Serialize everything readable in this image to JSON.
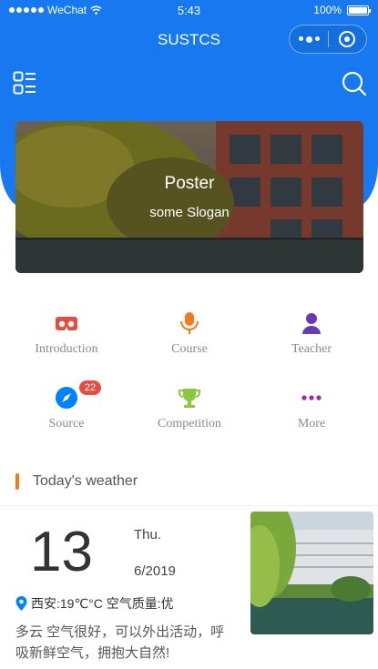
{
  "status_bar": {
    "carrier": "WeChat",
    "time": "5:43",
    "battery": "100%",
    "battery_level": 1.0
  },
  "nav": {
    "title": "SUSTCS"
  },
  "toolbar": {
    "menu_icon": "list-icon",
    "search_icon": "search-icon"
  },
  "banner": {
    "title": "Poster",
    "slogan": "some Slogan"
  },
  "grid": [
    {
      "label": "Introduction",
      "icon": "vr-glasses-icon",
      "color": "#e54d42"
    },
    {
      "label": "Course",
      "icon": "microphone-icon",
      "color": "#f37b1d"
    },
    {
      "label": "Teacher",
      "icon": "person-icon",
      "color": "#6739b6"
    },
    {
      "label": "Source",
      "icon": "compass-icon",
      "color": "#0081ff",
      "badge": "22"
    },
    {
      "label": "Competition",
      "icon": "trophy-icon",
      "color": "#8dc63f"
    },
    {
      "label": "More",
      "icon": "more-dots-icon",
      "color": "#9c26b0"
    }
  ],
  "weather": {
    "section_title": "Today's weather",
    "day": "13",
    "weekday": "Thu.",
    "month_year": "6/2019",
    "location": "西安:19℃°C 空气质量:优",
    "description": "多云 空气很好，可以外出活动，呼吸新鲜空气，拥抱大自然!"
  },
  "colors": {
    "primary": "#1778f0",
    "accent_bar": "#f37b1d",
    "badge": "#e54d42"
  }
}
